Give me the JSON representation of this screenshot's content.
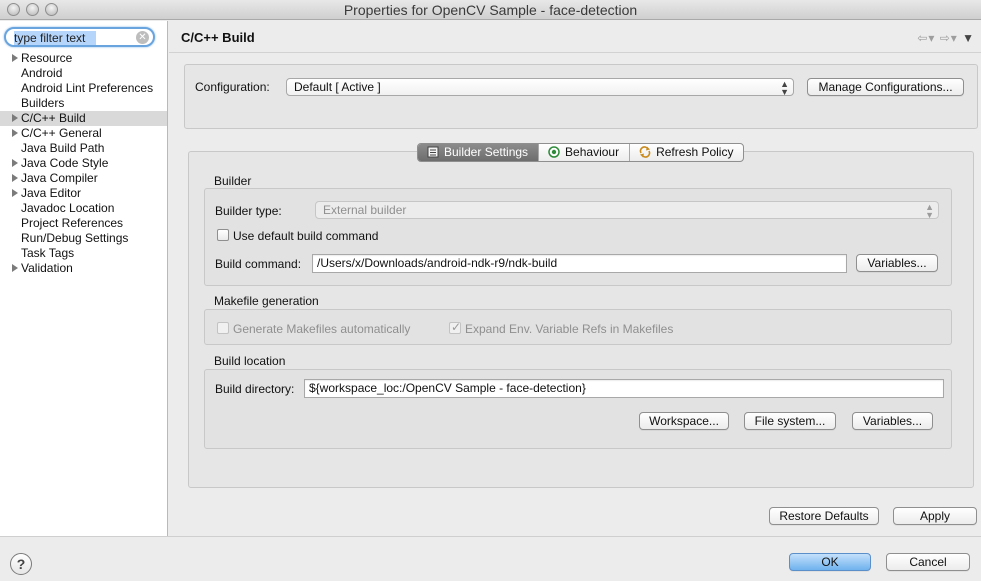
{
  "window": {
    "title": "Properties for OpenCV Sample - face-detection"
  },
  "sidebar": {
    "filter": {
      "value": "type filter text",
      "placeholder": "type filter text"
    },
    "items": [
      {
        "label": "Resource",
        "expandable": true
      },
      {
        "label": "Android",
        "expandable": false
      },
      {
        "label": "Android Lint Preferences",
        "expandable": false
      },
      {
        "label": "Builders",
        "expandable": false
      },
      {
        "label": "C/C++ Build",
        "expandable": true,
        "selected": true
      },
      {
        "label": "C/C++ General",
        "expandable": true
      },
      {
        "label": "Java Build Path",
        "expandable": false
      },
      {
        "label": "Java Code Style",
        "expandable": true
      },
      {
        "label": "Java Compiler",
        "expandable": true
      },
      {
        "label": "Java Editor",
        "expandable": true
      },
      {
        "label": "Javadoc Location",
        "expandable": false
      },
      {
        "label": "Project References",
        "expandable": false
      },
      {
        "label": "Run/Debug Settings",
        "expandable": false
      },
      {
        "label": "Task Tags",
        "expandable": false
      },
      {
        "label": "Validation",
        "expandable": true
      }
    ]
  },
  "page": {
    "title": "C/C++ Build",
    "configuration": {
      "label": "Configuration:",
      "value": "Default  [ Active ]",
      "manage_button": "Manage Configurations..."
    },
    "tabs": [
      {
        "label": "Builder Settings",
        "icon": "builder-settings-icon",
        "active": true
      },
      {
        "label": "Behaviour",
        "icon": "behaviour-icon",
        "active": false
      },
      {
        "label": "Refresh Policy",
        "icon": "refresh-policy-icon",
        "active": false
      }
    ],
    "builder": {
      "section_label": "Builder",
      "type_label": "Builder type:",
      "type_value": "External builder",
      "use_default_label": "Use default build command",
      "use_default_checked": false,
      "command_label": "Build command:",
      "command_value": "/Users/x/Downloads/android-ndk-r9/ndk-build",
      "variables_button": "Variables..."
    },
    "makefile": {
      "section_label": "Makefile generation",
      "generate_label": "Generate Makefiles automatically",
      "generate_checked": false,
      "expand_label": "Expand Env. Variable Refs in Makefiles",
      "expand_checked": true
    },
    "location": {
      "section_label": "Build location",
      "directory_label": "Build directory:",
      "directory_value": "${workspace_loc:/OpenCV Sample - face-detection}",
      "workspace_button": "Workspace...",
      "filesystem_button": "File system...",
      "variables_button": "Variables..."
    },
    "restore_defaults_button": "Restore Defaults",
    "apply_button": "Apply"
  },
  "dialog": {
    "help_glyph": "?",
    "ok_button": "OK",
    "cancel_button": "Cancel"
  },
  "colors": {
    "accent": "#6fb2ee",
    "selection": "#b5d5fb"
  }
}
